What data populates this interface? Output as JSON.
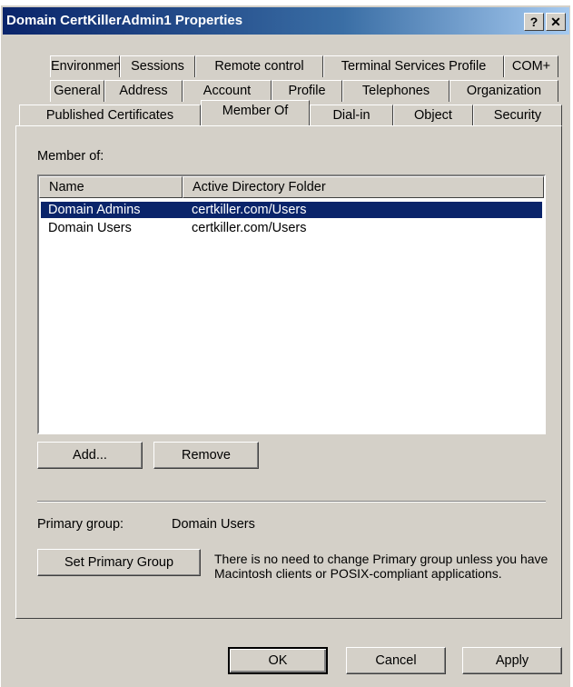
{
  "window": {
    "title": "Domain CertKillerAdmin1 Properties",
    "help_button": "?",
    "close_button": "✕"
  },
  "tabs": {
    "row1": [
      "Environment",
      "Sessions",
      "Remote control",
      "Terminal Services Profile",
      "COM+"
    ],
    "row2": [
      "General",
      "Address",
      "Account",
      "Profile",
      "Telephones",
      "Organization"
    ],
    "row3": [
      "Published Certificates",
      "Member Of",
      "Dial-in",
      "Object",
      "Security"
    ],
    "active": "Member Of"
  },
  "member_of": {
    "label": "Member of:",
    "columns": [
      "Name",
      "Active Directory Folder"
    ],
    "rows": [
      {
        "name": "Domain Admins",
        "folder": "certkiller.com/Users",
        "selected": true
      },
      {
        "name": "Domain Users",
        "folder": "certkiller.com/Users",
        "selected": false
      }
    ],
    "add_button": "Add...",
    "remove_button": "Remove"
  },
  "primary_group": {
    "label": "Primary group:",
    "value": "Domain Users",
    "set_button": "Set Primary Group",
    "note": "There is no need to change Primary group unless you have Macintosh clients or POSIX-compliant applications."
  },
  "footer": {
    "ok": "OK",
    "cancel": "Cancel",
    "apply": "Apply"
  },
  "colors": {
    "face": "#d4d0c8",
    "selection": "#0a246a",
    "title_start": "#0a246a",
    "title_end": "#a6caf0"
  }
}
